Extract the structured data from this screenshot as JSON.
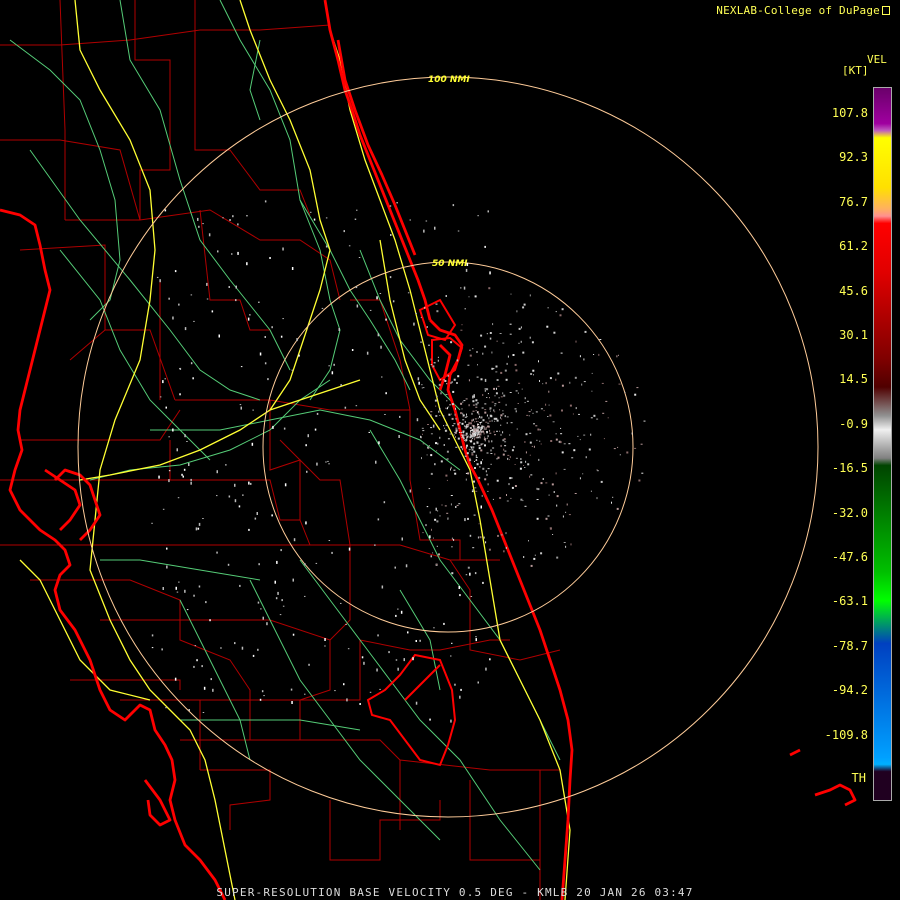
{
  "header": {
    "brand": "NEXLAB-College of DuPage"
  },
  "footer": {
    "caption": "SUPER-RESOLUTION BASE VELOCITY 0.5 DEG - KMLB 20 JAN 26 03:47"
  },
  "legend": {
    "product": "VEL",
    "unit": "[KT]",
    "labels": [
      "107.8",
      "92.3",
      "76.7",
      "61.2",
      "45.6",
      "30.1",
      "14.5",
      "-0.9",
      "-16.5",
      "-32.0",
      "-47.6",
      "-63.1",
      "-78.7",
      "-94.2",
      "-109.8",
      "TH"
    ]
  },
  "range_rings": [
    {
      "label": "100 NMI"
    },
    {
      "label": "50 NMI"
    }
  ],
  "colors": {
    "coastline": "#ff0000",
    "counties": "#cc0000",
    "highways": "#ffff33",
    "roads": "#66dd88",
    "rings": "#ffcc99",
    "echo": "#cccccc"
  },
  "icons": {
    "brand_mark": "nexlab-logo-icon"
  }
}
